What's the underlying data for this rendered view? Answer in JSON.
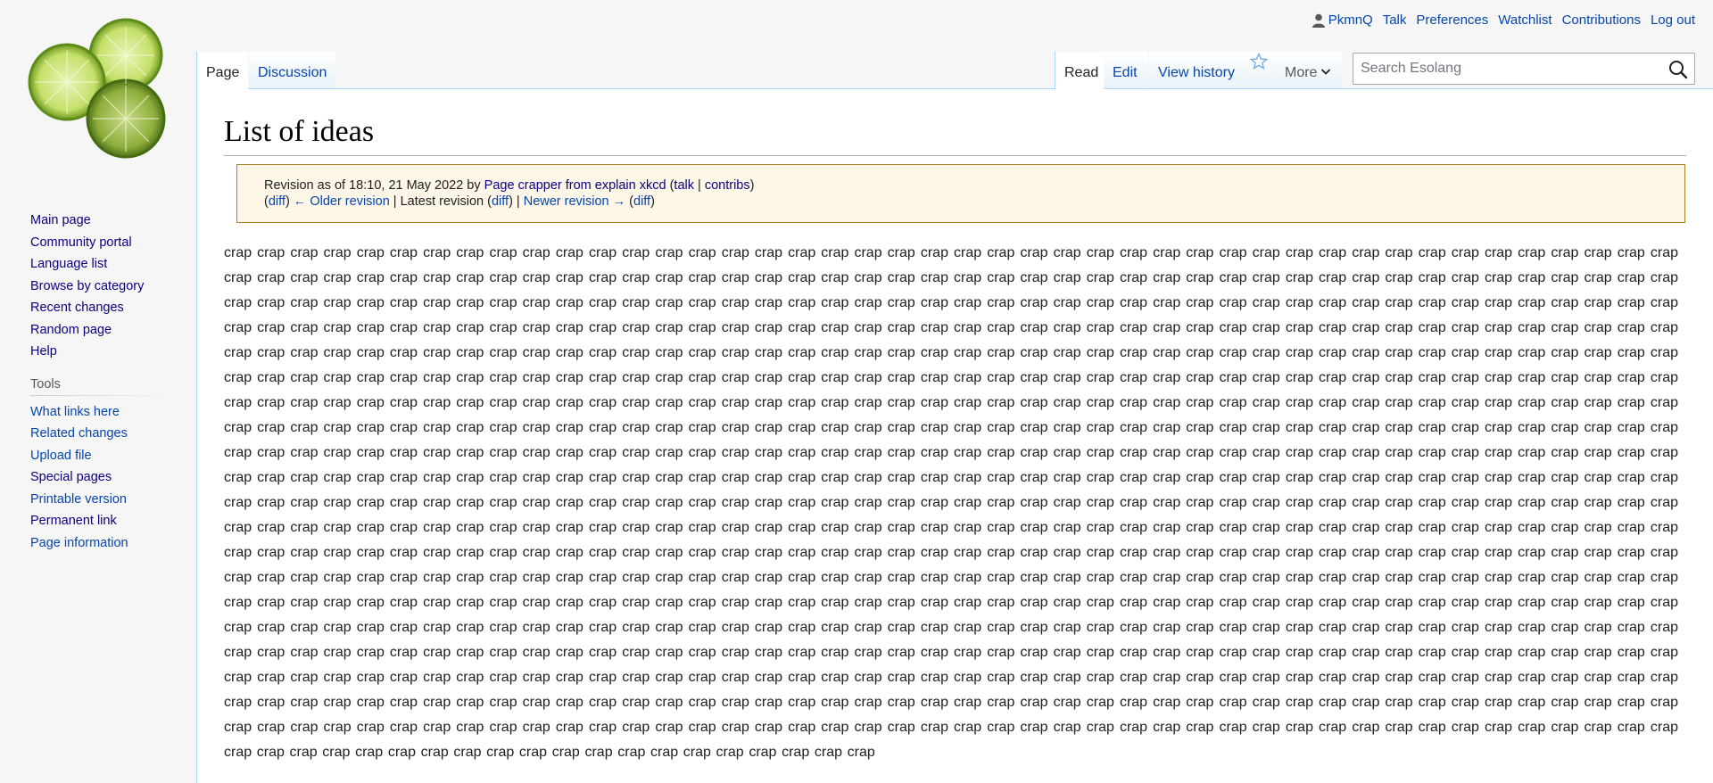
{
  "site": {
    "logo_alt": "Esolang"
  },
  "personal_tools": [
    {
      "name": "username",
      "label": "PkmnQ"
    },
    {
      "name": "talk",
      "label": "Talk"
    },
    {
      "name": "preferences",
      "label": "Preferences"
    },
    {
      "name": "watchlist",
      "label": "Watchlist"
    },
    {
      "name": "contributions",
      "label": "Contributions"
    },
    {
      "name": "logout",
      "label": "Log out"
    }
  ],
  "tabs": {
    "page": "Page",
    "discussion": "Discussion",
    "read": "Read",
    "edit": "Edit",
    "view_history": "View history",
    "more": "More"
  },
  "search": {
    "placeholder": "Search Esolang"
  },
  "navigation": [
    "Main page",
    "Community portal",
    "Language list",
    "Browse by category",
    "Recent changes",
    "Random page",
    "Help"
  ],
  "tools": {
    "heading": "Tools",
    "items": [
      "What links here",
      "Related changes",
      "Upload file",
      "Special pages",
      "Printable version",
      "Permanent link",
      "Page information"
    ]
  },
  "page": {
    "title": "List of ideas"
  },
  "revision": {
    "prefix": "Revision as of 18:10, 21 May 2022 by ",
    "author": "Page crapper from explain xkcd",
    "talk": "talk",
    "contribs": "contribs",
    "diff": "diff",
    "older": "← Older revision",
    "latest": "Latest revision",
    "newer": "Newer revision →"
  },
  "body": {
    "word": "crap"
  }
}
